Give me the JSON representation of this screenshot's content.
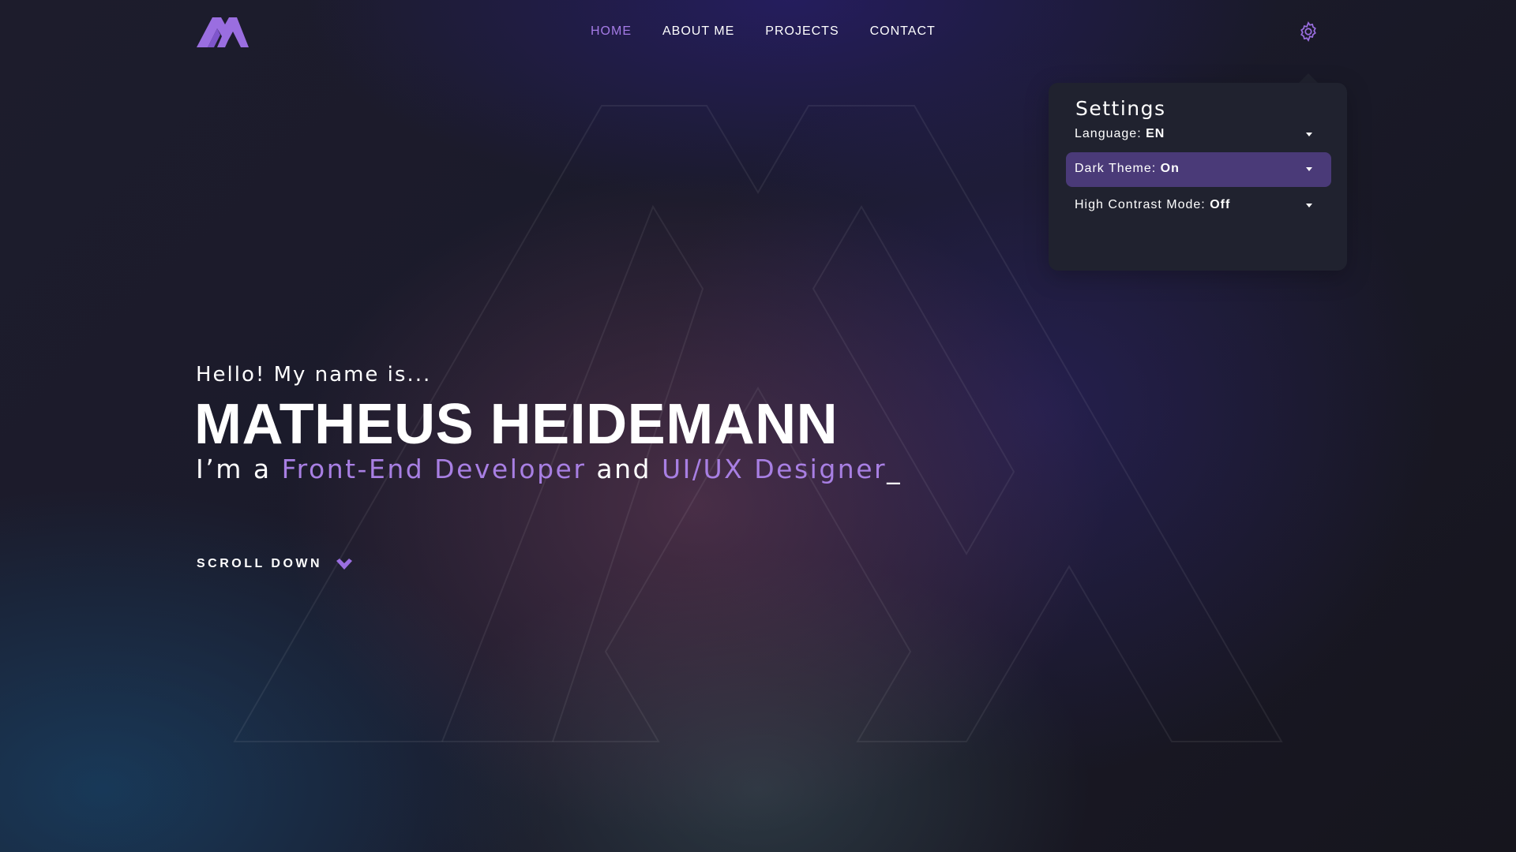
{
  "header": {
    "logo_icon": "m-monogram-logo-icon",
    "nav": [
      {
        "label": "HOME",
        "active": true
      },
      {
        "label": "ABOUT ME",
        "active": false
      },
      {
        "label": "PROJECTS",
        "active": false
      },
      {
        "label": "CONTACT",
        "active": false
      }
    ],
    "settings_icon": "gear-icon"
  },
  "settings": {
    "title": "Settings",
    "rows": [
      {
        "label": "Language:",
        "value": "EN",
        "highlighted": false
      },
      {
        "label": "Dark Theme:",
        "value": "On",
        "highlighted": true
      },
      {
        "label": "High Contrast Mode:",
        "value": "Off",
        "highlighted": false
      }
    ]
  },
  "hero": {
    "greeting": "Hello! My name is...",
    "name": "MATHEUS HEIDEMANN",
    "tagline_prefix": "I’m a",
    "role_1": "Front-End Developer",
    "tagline_conjunction": "and",
    "role_2": "UI/UX Designer",
    "cursor": "_"
  },
  "scroll": {
    "label": "SCROLL DOWN",
    "icon": "chevron-down-icon"
  },
  "colors": {
    "accent": "#a57be6",
    "panel": "#20222f",
    "highlight": "#4a3a78",
    "background": "#171827"
  }
}
